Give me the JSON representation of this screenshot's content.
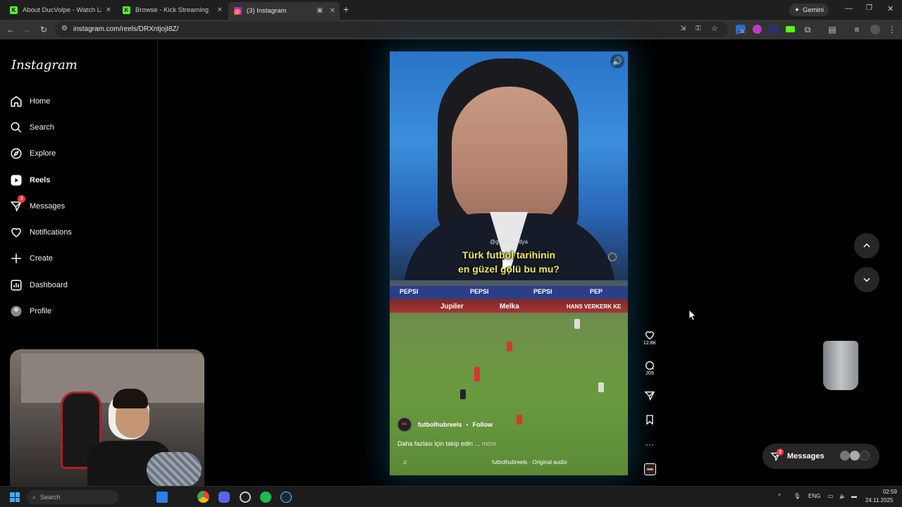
{
  "browser": {
    "tabs": [
      {
        "title": "About DucVolpe - Watch Live o",
        "favicon": "kick-logo",
        "active": false
      },
      {
        "title": "Browse - Kick Streaming",
        "favicon": "kick-logo",
        "active": false
      },
      {
        "title": "(3) Instagram",
        "favicon": "instagram-logo",
        "active": true
      }
    ],
    "new_tab": "+",
    "gemini_label": "Gemini",
    "url": "instagram.com/reels/DRXntjojI8Z/",
    "extension_badge": "28"
  },
  "sidebar": {
    "logo": "Instagram",
    "items": [
      {
        "label": "Home",
        "icon": "home-icon"
      },
      {
        "label": "Search",
        "icon": "search-icon"
      },
      {
        "label": "Explore",
        "icon": "compass-icon"
      },
      {
        "label": "Reels",
        "icon": "reels-icon",
        "active": true
      },
      {
        "label": "Messages",
        "icon": "messenger-icon",
        "badge": "3"
      },
      {
        "label": "Notifications",
        "icon": "heart-icon"
      },
      {
        "label": "Create",
        "icon": "plus-icon"
      },
      {
        "label": "Dashboard",
        "icon": "chart-icon"
      },
      {
        "label": "Profile",
        "icon": "avatar-icon"
      }
    ]
  },
  "reel": {
    "watermark": "@golnetmedya",
    "caption_line1": "Türk futbol tarihinin",
    "caption_line2": "en güzel golü bu mu?",
    "username": "futbolhubreels",
    "separator": "•",
    "follow_label": "Follow",
    "description": "Daha fazlası için takip edin ...",
    "more_label": "more",
    "audio": "futbolhubreels · Original audio",
    "ad_boards": [
      "PEPSI",
      "PEPSI",
      "PEPSI",
      "PEP",
      "Jupiler",
      "Melka",
      "HANS VERKERK KE"
    ]
  },
  "actions": {
    "likes": "12.8K",
    "comments": "209"
  },
  "messages_pill": {
    "label": "Messages",
    "badge": "3"
  },
  "taskbar": {
    "search_placeholder": "Search",
    "language": "ENG",
    "time": "02:59",
    "date": "24.11.2025"
  },
  "colors": {
    "accent_badge": "#ff3040",
    "caption_yellow": "#f2ef4a",
    "ui_dark": "#262626"
  }
}
